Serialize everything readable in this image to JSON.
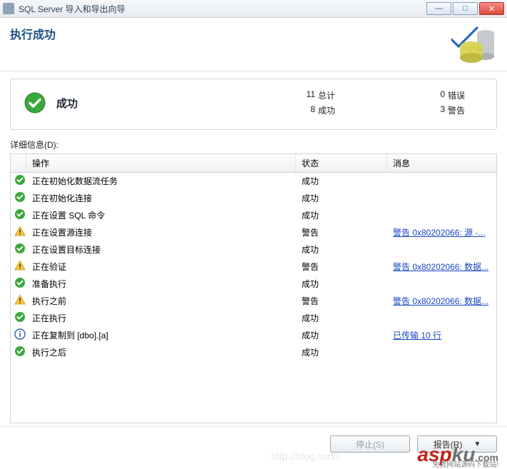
{
  "window": {
    "title": "SQL Server 导入和导出向导"
  },
  "header": {
    "title": "执行成功"
  },
  "summary": {
    "status": "成功",
    "total_num": "11",
    "total_label": "总计",
    "success_num": "8",
    "success_label": "成功",
    "error_num": "0",
    "error_label": "错误",
    "warn_num": "3",
    "warn_label": "警告"
  },
  "details": {
    "label": "详细信息(D):",
    "cols": {
      "op": "操作",
      "status": "状态",
      "msg": "消息"
    },
    "rows": [
      {
        "icon": "ok",
        "op": "正在初始化数据流任务",
        "status": "成功",
        "msg": ""
      },
      {
        "icon": "ok",
        "op": "正在初始化连接",
        "status": "成功",
        "msg": ""
      },
      {
        "icon": "ok",
        "op": "正在设置 SQL 命令",
        "status": "成功",
        "msg": ""
      },
      {
        "icon": "warn",
        "op": "正在设置源连接",
        "status": "警告",
        "msg": "警告 0x80202066: 源 -..."
      },
      {
        "icon": "ok",
        "op": "正在设置目标连接",
        "status": "成功",
        "msg": ""
      },
      {
        "icon": "warn",
        "op": "正在验证",
        "status": "警告",
        "msg": "警告 0x80202066: 数据..."
      },
      {
        "icon": "ok",
        "op": "准备执行",
        "status": "成功",
        "msg": ""
      },
      {
        "icon": "warn",
        "op": "执行之前",
        "status": "警告",
        "msg": "警告 0x80202066: 数据..."
      },
      {
        "icon": "ok",
        "op": "正在执行",
        "status": "成功",
        "msg": ""
      },
      {
        "icon": "info",
        "op": "正在复制到 [dbo].[a]",
        "status": "成功",
        "msg": "已传输 10 行"
      },
      {
        "icon": "ok",
        "op": "执行之后",
        "status": "成功",
        "msg": ""
      }
    ]
  },
  "footer": {
    "stop": "停止(S)",
    "report": "报告(R)"
  },
  "watermark": {
    "blog": "http://blog.csdn",
    "brand_r": "asp",
    "brand_g": "ku",
    "dot": ".com",
    "sub": "免费网站源码下载站!"
  }
}
